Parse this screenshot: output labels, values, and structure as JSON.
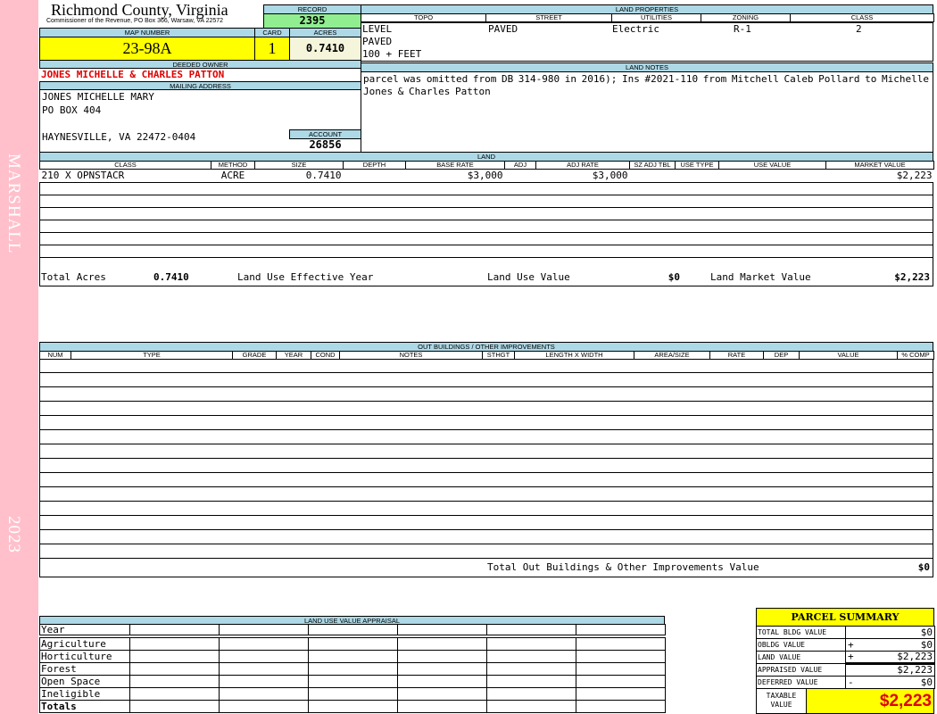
{
  "sidebar": {
    "name": "MARSHALL",
    "year": "2023",
    "color": "#ffc0cb"
  },
  "header": {
    "title": "Richmond County, Virginia",
    "subtitle": "Commissioner of the Revenue, PO Box 366, Warsaw, VA 22572"
  },
  "record": {
    "label": "RECORD",
    "value": "2395"
  },
  "parcel": {
    "map_label": "MAP NUMBER",
    "map_number": "23-98A",
    "card_label": "CARD",
    "card": "1",
    "acres_label": "ACRES",
    "acres": "0.7410"
  },
  "owner": {
    "label": "DEEDED OWNER",
    "name": "JONES MICHELLE & CHARLES PATTON",
    "mailing_label": "MAILING ADDRESS",
    "line1": "JONES MICHELLE MARY",
    "line2": "PO BOX 404",
    "line3": "HAYNESVILLE, VA 22472-0404",
    "account_label": "ACCOUNT",
    "account": "26856"
  },
  "land_properties": {
    "label": "LAND PROPERTIES",
    "headers": [
      "TOPO",
      "STREET",
      "UTILITIES",
      "ZONING",
      "CLASS"
    ],
    "topo": [
      "LEVEL",
      "PAVED",
      "100 + FEET"
    ],
    "street": "PAVED",
    "utilities": "Electric",
    "zoning": "R-1",
    "class": "2"
  },
  "land_notes": {
    "label": "LAND NOTES",
    "text": "parcel was omitted from DB 314-980 in 2016); Ins #2021-110 from Mitchell Caleb Pollard to Michelle Jones & Charles Patton"
  },
  "land": {
    "label": "LAND",
    "headers": [
      "CLASS",
      "METHOD",
      "SIZE",
      "DEPTH",
      "BASE RATE",
      "ADJ",
      "ADJ RATE",
      "SZ ADJ TBL",
      "USE TYPE",
      "USE VALUE",
      "MARKET VALUE"
    ],
    "rows": [
      [
        "210 X OPNSTACR",
        "ACRE",
        "0.7410",
        "",
        "$3,000",
        "",
        "$3,000",
        "",
        "",
        "",
        "$2,223"
      ]
    ],
    "total_acres_label": "Total Acres",
    "total_acres": "0.7410",
    "effective_year_label": "Land Use Effective Year",
    "effective_year": "",
    "use_value_label": "Land Use Value",
    "use_value": "$0",
    "market_value_label": "Land Market Value",
    "market_value": "$2,223"
  },
  "outbuildings": {
    "label": "OUT BUILDINGS / OTHER IMPROVEMENTS",
    "headers": [
      "NUM",
      "TYPE",
      "GRADE",
      "YEAR",
      "COND",
      "NOTES",
      "STHGT",
      "LENGTH X WIDTH",
      "AREA/SIZE",
      "RATE",
      "DEP",
      "VALUE",
      "% COMP"
    ],
    "total_label": "Total Out Buildings & Other Improvements Value",
    "total": "$0"
  },
  "land_use": {
    "label": "LAND USE VALUE APPRAISAL",
    "year_label": "Year",
    "rows": [
      "Agriculture",
      "Horticulture",
      "Forest",
      "Open Space",
      "Ineligible"
    ],
    "totals_label": "Totals"
  },
  "summary": {
    "label": "PARCEL SUMMARY",
    "rows": [
      {
        "label": "TOTAL BLDG VALUE",
        "op": "",
        "value": "$0"
      },
      {
        "label": "OBLDG VALUE",
        "op": "+",
        "value": "$0"
      },
      {
        "label": "LAND VALUE",
        "op": "+",
        "value": "$2,223"
      },
      {
        "label": "APPRAISED VALUE",
        "op": "",
        "value": "$2,223"
      },
      {
        "label": "DEFERRED VALUE",
        "op": "-",
        "value": "$0"
      }
    ],
    "taxable_label": "TAXABLE VALUE",
    "taxable": "$2,223"
  }
}
